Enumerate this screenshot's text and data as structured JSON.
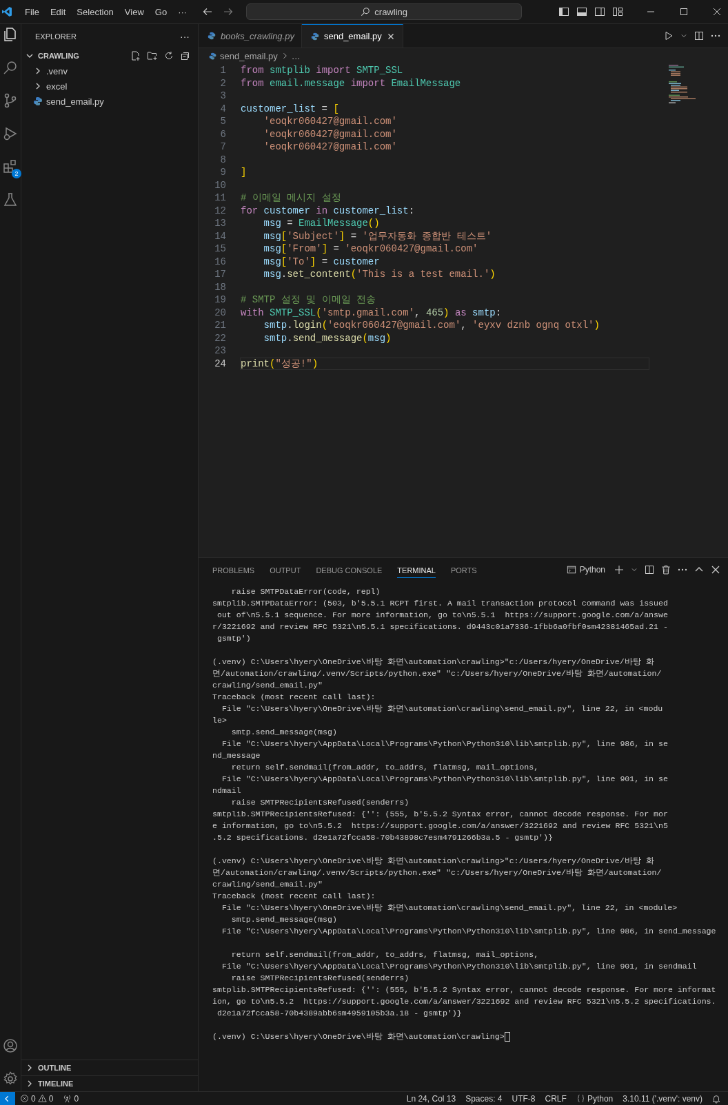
{
  "title_bar": {
    "menus": [
      "File",
      "Edit",
      "Selection",
      "View",
      "Go"
    ],
    "overflow": "···",
    "search": "crawling"
  },
  "activity_bar": {
    "extensions_badge": "2"
  },
  "sidebar": {
    "title": "EXPLORER",
    "more": "···",
    "folder": {
      "label": "CRAWLING",
      "expanded": true,
      "children": [
        {
          "label": ".venv",
          "kind": "folder",
          "expanded": false
        },
        {
          "label": "excel",
          "kind": "folder",
          "expanded": false
        },
        {
          "label": "send_email.py",
          "kind": "file"
        }
      ]
    },
    "sections": [
      {
        "label": "OUTLINE",
        "expanded": false
      },
      {
        "label": "TIMELINE",
        "expanded": false
      }
    ]
  },
  "editor": {
    "tabs": [
      {
        "label": "books_crawling.py",
        "selected": false,
        "preview": true
      },
      {
        "label": "send_email.py",
        "selected": true,
        "preview": false
      }
    ],
    "breadcrumb": {
      "file": "send_email.py",
      "rest": "…"
    },
    "lines": [
      {
        "number": "1",
        "current": false,
        "tokens": [
          {
            "kind": "kw",
            "text": "from "
          },
          {
            "kind": "cls",
            "text": "smtplib "
          },
          {
            "kind": "kw",
            "text": "import "
          },
          {
            "kind": "cls",
            "text": "SMTP_SSL"
          }
        ]
      },
      {
        "number": "2",
        "current": false,
        "tokens": [
          {
            "kind": "kw",
            "text": "from "
          },
          {
            "kind": "cls",
            "text": "email.message "
          },
          {
            "kind": "kw",
            "text": "import "
          },
          {
            "kind": "cls",
            "text": "EmailMessage"
          }
        ]
      },
      {
        "number": "3",
        "current": false
      },
      {
        "number": "4",
        "current": false,
        "tokens": [
          {
            "kind": "var",
            "text": "customer_list"
          },
          {
            "kind": "op",
            "text": " = "
          },
          {
            "kind": "b1",
            "text": "["
          }
        ]
      },
      {
        "number": "5",
        "current": false,
        "tokens": [
          {
            "kind": "str",
            "text": "    'eoqkr060427@gmail.com'"
          }
        ]
      },
      {
        "number": "6",
        "current": false,
        "tokens": [
          {
            "kind": "str",
            "text": "    'eoqkr060427@gmail.com'"
          }
        ]
      },
      {
        "number": "7",
        "current": false,
        "tokens": [
          {
            "kind": "str",
            "text": "    'eoqkr060427@gmail.com'"
          }
        ]
      },
      {
        "number": "8",
        "current": false
      },
      {
        "number": "9",
        "current": false,
        "tokens": [
          {
            "kind": "b1",
            "text": "]"
          }
        ]
      },
      {
        "number": "10",
        "current": false
      },
      {
        "number": "11",
        "current": false,
        "tokens": [
          {
            "kind": "com",
            "text": "# 이메일 메시지 설정"
          }
        ]
      },
      {
        "number": "12",
        "current": false,
        "tokens": [
          {
            "kind": "kw",
            "text": "for "
          },
          {
            "kind": "var",
            "text": "customer "
          },
          {
            "kind": "kw",
            "text": "in "
          },
          {
            "kind": "var",
            "text": "customer_list"
          },
          {
            "kind": "op",
            "text": ":"
          }
        ]
      },
      {
        "number": "13",
        "current": false,
        "tokens": [
          {
            "kind": "var",
            "text": "    msg"
          },
          {
            "kind": "op",
            "text": " = "
          },
          {
            "kind": "cls",
            "text": "EmailMessage"
          },
          {
            "kind": "b1",
            "text": "()"
          }
        ]
      },
      {
        "number": "14",
        "current": false,
        "tokens": [
          {
            "kind": "var",
            "text": "    msg"
          },
          {
            "kind": "b1",
            "text": "["
          },
          {
            "kind": "str",
            "text": "'Subject'"
          },
          {
            "kind": "b1",
            "text": "]"
          },
          {
            "kind": "op",
            "text": " = "
          },
          {
            "kind": "str",
            "text": "'업무자동화 종합반 테스트'"
          }
        ]
      },
      {
        "number": "15",
        "current": false,
        "tokens": [
          {
            "kind": "var",
            "text": "    msg"
          },
          {
            "kind": "b1",
            "text": "["
          },
          {
            "kind": "str",
            "text": "'From'"
          },
          {
            "kind": "b1",
            "text": "]"
          },
          {
            "kind": "op",
            "text": " = "
          },
          {
            "kind": "str",
            "text": "'eoqkr060427@gmail.com'"
          }
        ]
      },
      {
        "number": "16",
        "current": false,
        "tokens": [
          {
            "kind": "var",
            "text": "    msg"
          },
          {
            "kind": "b1",
            "text": "["
          },
          {
            "kind": "str",
            "text": "'To'"
          },
          {
            "kind": "b1",
            "text": "]"
          },
          {
            "kind": "op",
            "text": " = "
          },
          {
            "kind": "var",
            "text": "customer"
          }
        ]
      },
      {
        "number": "17",
        "current": false,
        "tokens": [
          {
            "kind": "var",
            "text": "    msg"
          },
          {
            "kind": "op",
            "text": "."
          },
          {
            "kind": "fn",
            "text": "set_content"
          },
          {
            "kind": "b1",
            "text": "("
          },
          {
            "kind": "str",
            "text": "'This is a test email.'"
          },
          {
            "kind": "b1",
            "text": ")"
          }
        ]
      },
      {
        "number": "18",
        "current": false
      },
      {
        "number": "19",
        "current": false,
        "tokens": [
          {
            "kind": "com",
            "text": "# SMTP 설정 및 이메일 전송"
          }
        ]
      },
      {
        "number": "20",
        "current": false,
        "tokens": [
          {
            "kind": "kw",
            "text": "with "
          },
          {
            "kind": "cls",
            "text": "SMTP_SSL"
          },
          {
            "kind": "b1",
            "text": "("
          },
          {
            "kind": "str",
            "text": "'smtp.gmail.com'"
          },
          {
            "kind": "op",
            "text": ", "
          },
          {
            "kind": "num",
            "text": "465"
          },
          {
            "kind": "b1",
            "text": ")"
          },
          {
            "kind": "kw",
            "text": " as "
          },
          {
            "kind": "var",
            "text": "smtp"
          },
          {
            "kind": "op",
            "text": ":"
          }
        ]
      },
      {
        "number": "21",
        "current": false,
        "tokens": [
          {
            "kind": "var",
            "text": "    smtp"
          },
          {
            "kind": "op",
            "text": "."
          },
          {
            "kind": "fn",
            "text": "login"
          },
          {
            "kind": "b1",
            "text": "("
          },
          {
            "kind": "str",
            "text": "'eoqkr060427@gmail.com'"
          },
          {
            "kind": "op",
            "text": ", "
          },
          {
            "kind": "str",
            "text": "'eyxv dznb ognq otxl'"
          },
          {
            "kind": "b1",
            "text": ")"
          }
        ]
      },
      {
        "number": "22",
        "current": false,
        "tokens": [
          {
            "kind": "var",
            "text": "    smtp"
          },
          {
            "kind": "op",
            "text": "."
          },
          {
            "kind": "fn",
            "text": "send_message"
          },
          {
            "kind": "b1",
            "text": "("
          },
          {
            "kind": "var",
            "text": "msg"
          },
          {
            "kind": "b1",
            "text": ")"
          }
        ]
      },
      {
        "number": "23",
        "current": false
      },
      {
        "number": "24",
        "current": true,
        "tokens": [
          {
            "kind": "fn",
            "text": "print"
          },
          {
            "kind": "b1",
            "text": "("
          },
          {
            "kind": "str",
            "text": "\"성공!\""
          },
          {
            "kind": "b1",
            "text": ")"
          }
        ]
      }
    ]
  },
  "panel": {
    "tabs": [
      {
        "label": "PROBLEMS",
        "selected": false
      },
      {
        "label": "OUTPUT",
        "selected": false
      },
      {
        "label": "DEBUG CONSOLE",
        "selected": false
      },
      {
        "label": "TERMINAL",
        "selected": true
      },
      {
        "label": "PORTS",
        "selected": false
      }
    ],
    "profile": "Python",
    "blocks": [
      {
        "lines": [
          "    raise SMTPDataError(code, repl)",
          "smtplib.SMTPDataError: (503, b'5.5.1 RCPT first. A mail transaction protocol command was issued",
          " out of\\n5.5.1 sequence. For more information, go to\\n5.5.1  https://support.google.com/a/answe",
          "r/3221692 and review RFC 5321\\n5.5.1 specifications. d9443c01a7336-1fbb6a0fbf0sm42381465ad.21 -",
          " gsmtp')"
        ]
      },
      {
        "lines": [
          "(.venv) C:\\Users\\hyery\\OneDrive\\바탕 화면\\automation\\crawling>\"c:/Users/hyery/OneDrive/바탕 화",
          "면/automation/crawling/.venv/Scripts/python.exe\" \"c:/Users/hyery/OneDrive/바탕 화면/automation/",
          "crawling/send_email.py\"",
          "Traceback (most recent call last):",
          "  File \"c:\\Users\\hyery\\OneDrive\\바탕 화면\\automation\\crawling\\send_email.py\", line 22, in <modu",
          "le>",
          "    smtp.send_message(msg)",
          "  File \"C:\\Users\\hyery\\AppData\\Local\\Programs\\Python\\Python310\\lib\\smtplib.py\", line 986, in se",
          "nd_message",
          "    return self.sendmail(from_addr, to_addrs, flatmsg, mail_options,",
          "  File \"C:\\Users\\hyery\\AppData\\Local\\Programs\\Python\\Python310\\lib\\smtplib.py\", line 901, in se",
          "ndmail",
          "    raise SMTPRecipientsRefused(senderrs)",
          "smtplib.SMTPRecipientsRefused: {'': (555, b'5.5.2 Syntax error, cannot decode response. For mor",
          "e information, go to\\n5.5.2  https://support.google.com/a/answer/3221692 and review RFC 5321\\n5",
          ".5.2 specifications. d2e1a72fcca58-70b43898c7esm4791266b3a.5 - gsmtp')}"
        ]
      },
      {
        "lines": [
          "(.venv) C:\\Users\\hyery\\OneDrive\\바탕 화면\\automation\\crawling>\"c:/Users/hyery/OneDrive/바탕 화",
          "면/automation/crawling/.venv/Scripts/python.exe\" \"c:/Users/hyery/OneDrive/바탕 화면/automation/",
          "crawling/send_email.py\"",
          "Traceback (most recent call last):",
          "  File \"c:\\Users\\hyery\\OneDrive\\바탕 화면\\automation\\crawling\\send_email.py\", line 22, in <module>",
          "    smtp.send_message(msg)",
          "  File \"C:\\Users\\hyery\\AppData\\Local\\Programs\\Python\\Python310\\lib\\smtplib.py\", line 986, in send_message"
        ]
      },
      {
        "lines": [
          "    return self.sendmail(from_addr, to_addrs, flatmsg, mail_options,",
          "  File \"C:\\Users\\hyery\\AppData\\Local\\Programs\\Python\\Python310\\lib\\smtplib.py\", line 901, in sendmail",
          "    raise SMTPRecipientsRefused(senderrs)",
          "smtplib.SMTPRecipientsRefused: {'': (555, b'5.5.2 Syntax error, cannot decode response. For more informat",
          "ion, go to\\n5.5.2  https://support.google.com/a/answer/3221692 and review RFC 5321\\n5.5.2 specifications.",
          " d2e1a72fcca58-70b4389abb6sm4959105b3a.18 - gsmtp')}"
        ]
      }
    ],
    "prompt": "(.venv) C:\\Users\\hyery\\OneDrive\\바탕 화면\\automation\\crawling>"
  },
  "status_bar": {
    "errors": "0",
    "warnings": "0",
    "ports": "0",
    "items": [
      {
        "kind": "plain",
        "text": "Ln 24, Col 13"
      },
      {
        "kind": "plain",
        "text": "Spaces: 4"
      },
      {
        "kind": "plain",
        "text": "UTF-8"
      },
      {
        "kind": "plain",
        "text": "CRLF"
      },
      {
        "kind": "language",
        "text": "Python"
      },
      {
        "kind": "plain",
        "text": "3.10.11 ('.venv': venv)"
      }
    ]
  }
}
